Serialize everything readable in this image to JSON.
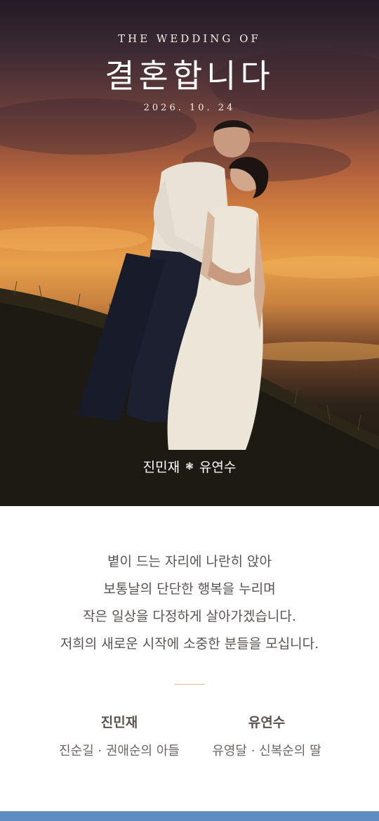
{
  "hero": {
    "eyebrow": "THE WEDDING OF",
    "title": "결혼합니다",
    "date": "2026. 10. 24",
    "groom": "진민재",
    "bride": "유연수",
    "separator": "❃"
  },
  "invitation": {
    "lines": [
      "볕이 드는 자리에 나란히 앉아",
      "보통날의 단단한 행복을 누리며",
      "작은 일상을 다정하게 살아가겠습니다.",
      "저희의 새로운 시작에 소중한 분들을 모십니다."
    ]
  },
  "parents": {
    "groom_name": "진민재",
    "groom_parents": "진순길 · 권애순의 아들",
    "bride_name": "유연수",
    "bride_parents": "유영달 · 신복순의 딸"
  },
  "colors": {
    "accent_divider": "#e9b99c",
    "bottom_bar": "#5f8cc2",
    "text": "#5b5350"
  }
}
